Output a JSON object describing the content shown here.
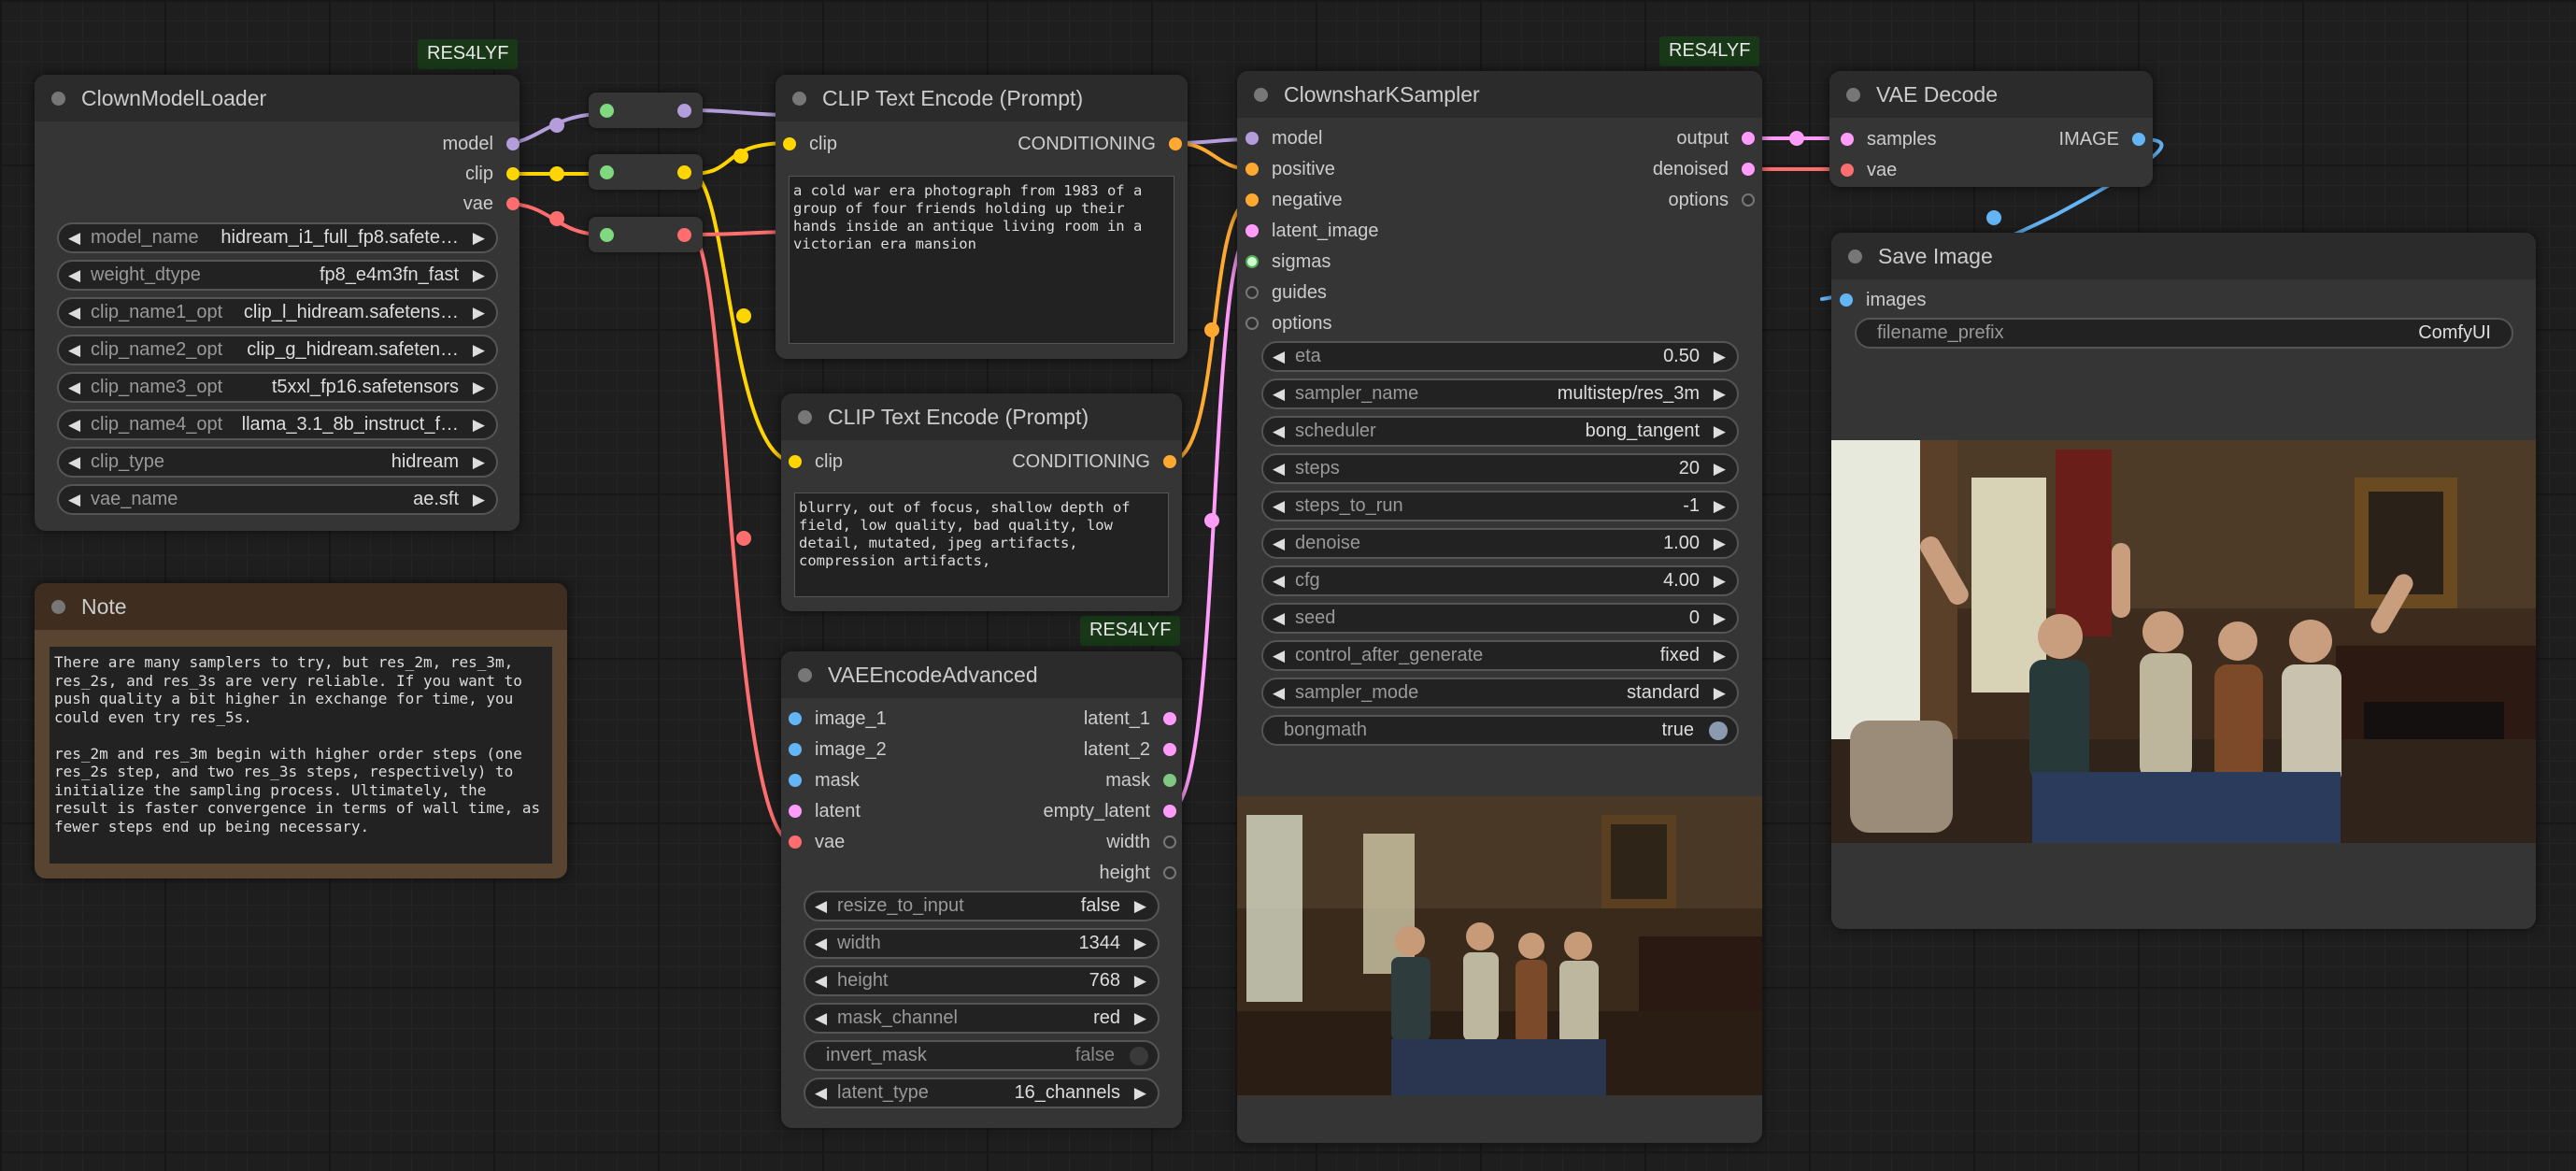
{
  "colors": {
    "model": "#b39ddb",
    "clip": "#ffd500",
    "vae": "#ff6e6e",
    "conditioning": "#ffa931",
    "latent": "#ff9cf9",
    "image": "#64b5f6",
    "mask": "#81c784",
    "sigmas": "#cdffcd",
    "other": "#777777"
  },
  "badges": {
    "loader": "RES4LYF",
    "sampler": "RES4LYF",
    "vae_encode": "RES4LYF"
  },
  "loader": {
    "title": "ClownModelLoader",
    "outputs": [
      "model",
      "clip",
      "vae"
    ],
    "widgets": [
      {
        "label": "model_name",
        "value": "hidream_i1_full_fp8.safete…"
      },
      {
        "label": "weight_dtype",
        "value": "fp8_e4m3fn_fast"
      },
      {
        "label": "clip_name1_opt",
        "value": "clip_l_hidream.safetens…"
      },
      {
        "label": "clip_name2_opt",
        "value": "clip_g_hidream.safeten…"
      },
      {
        "label": "clip_name3_opt",
        "value": "t5xxl_fp16.safetensors"
      },
      {
        "label": "clip_name4_opt",
        "value": "llama_3.1_8b_instruct_f…"
      },
      {
        "label": "clip_type",
        "value": "hidream"
      },
      {
        "label": "vae_name",
        "value": "ae.sft"
      }
    ]
  },
  "note": {
    "title": "Note",
    "text": "There are many samplers to try, but res_2m, res_3m, res_2s, and res_3s are very reliable. If you want to push quality a bit higher in exchange for time, you could even try res_5s.\n\nres_2m and res_3m begin with higher order steps (one res_2s step, and two res_3s steps, respectively) to initialize the sampling process. Ultimately, the result is faster convergence in terms of wall time, as fewer steps end up being necessary."
  },
  "clip_pos": {
    "title": "CLIP Text Encode (Prompt)",
    "input": "clip",
    "output": "CONDITIONING",
    "text": "a cold war era photograph from 1983 of a group of four friends holding up their hands inside an antique living room in a victorian era mansion"
  },
  "clip_neg": {
    "title": "CLIP Text Encode (Prompt)",
    "input": "clip",
    "output": "CONDITIONING",
    "text": "blurry, out of focus, shallow depth of field, low quality, bad quality, low detail, mutated, jpeg artifacts, compression artifacts,"
  },
  "vae_encode": {
    "title": "VAEEncodeAdvanced",
    "inputs": [
      "image_1",
      "image_2",
      "mask",
      "latent",
      "vae"
    ],
    "outputs": [
      "latent_1",
      "latent_2",
      "mask",
      "empty_latent",
      "width",
      "height"
    ],
    "widgets": [
      {
        "label": "resize_to_input",
        "value": "false"
      },
      {
        "label": "width",
        "value": "1344"
      },
      {
        "label": "height",
        "value": "768"
      },
      {
        "label": "mask_channel",
        "value": "red"
      },
      {
        "label": "latent_type",
        "value": "16_channels"
      }
    ],
    "toggle": {
      "label": "invert_mask",
      "value": "false"
    }
  },
  "sampler": {
    "title": "ClownsharKSampler",
    "inputs": [
      "model",
      "positive",
      "negative",
      "latent_image",
      "sigmas",
      "guides",
      "options"
    ],
    "outputs": [
      "output",
      "denoised",
      "options"
    ],
    "widgets": [
      {
        "label": "eta",
        "value": "0.50"
      },
      {
        "label": "sampler_name",
        "value": "multistep/res_3m"
      },
      {
        "label": "scheduler",
        "value": "bong_tangent"
      },
      {
        "label": "steps",
        "value": "20"
      },
      {
        "label": "steps_to_run",
        "value": "-1"
      },
      {
        "label": "denoise",
        "value": "1.00"
      },
      {
        "label": "cfg",
        "value": "4.00"
      },
      {
        "label": "seed",
        "value": "0"
      },
      {
        "label": "control_after_generate",
        "value": "fixed"
      },
      {
        "label": "sampler_mode",
        "value": "standard"
      }
    ],
    "toggle": {
      "label": "bongmath",
      "value": "true"
    }
  },
  "vae_decode": {
    "title": "VAE Decode",
    "inputs": [
      "samples",
      "vae"
    ],
    "output": "IMAGE"
  },
  "save_image": {
    "title": "Save Image",
    "input": "images",
    "widget": {
      "label": "filename_prefix",
      "value": "ComfyUI"
    }
  }
}
